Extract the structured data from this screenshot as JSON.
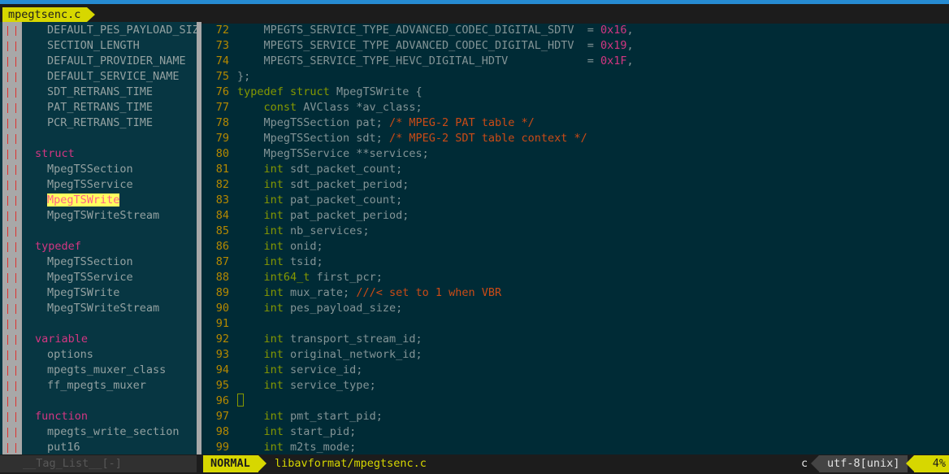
{
  "tab": {
    "label": "mpegtsenc.c"
  },
  "taglist": {
    "rows": [
      {
        "kind": "item",
        "text": "DEFAULT_PES_PAYLOAD_SIZE"
      },
      {
        "kind": "item",
        "text": "SECTION_LENGTH"
      },
      {
        "kind": "item",
        "text": "DEFAULT_PROVIDER_NAME"
      },
      {
        "kind": "item",
        "text": "DEFAULT_SERVICE_NAME"
      },
      {
        "kind": "item",
        "text": "SDT_RETRANS_TIME"
      },
      {
        "kind": "item",
        "text": "PAT_RETRANS_TIME"
      },
      {
        "kind": "item",
        "text": "PCR_RETRANS_TIME"
      },
      {
        "kind": "blank",
        "text": ""
      },
      {
        "kind": "header",
        "text": "struct"
      },
      {
        "kind": "item",
        "text": "MpegTSSection"
      },
      {
        "kind": "item",
        "text": "MpegTSService"
      },
      {
        "kind": "item-hl",
        "text": "MpegTSWrite"
      },
      {
        "kind": "item",
        "text": "MpegTSWriteStream"
      },
      {
        "kind": "blank",
        "text": ""
      },
      {
        "kind": "header",
        "text": "typedef"
      },
      {
        "kind": "item",
        "text": "MpegTSSection"
      },
      {
        "kind": "item",
        "text": "MpegTSService"
      },
      {
        "kind": "item",
        "text": "MpegTSWrite"
      },
      {
        "kind": "item",
        "text": "MpegTSWriteStream"
      },
      {
        "kind": "blank",
        "text": ""
      },
      {
        "kind": "header",
        "text": "variable"
      },
      {
        "kind": "item",
        "text": "options"
      },
      {
        "kind": "item",
        "text": "mpegts_muxer_class"
      },
      {
        "kind": "item",
        "text": "ff_mpegts_muxer"
      },
      {
        "kind": "blank",
        "text": ""
      },
      {
        "kind": "header",
        "text": "function"
      },
      {
        "kind": "item",
        "text": "mpegts_write_section"
      },
      {
        "kind": "item",
        "text": "put16"
      }
    ]
  },
  "code": {
    "lines": [
      {
        "n": "72",
        "parts": [
          [
            "txt",
            "    MPEGTS_SERVICE_TYPE_ADVANCED_CODEC_DIGITAL_SDTV  = "
          ],
          [
            "nm",
            "0x16"
          ],
          [
            "txt",
            ","
          ]
        ]
      },
      {
        "n": "73",
        "parts": [
          [
            "txt",
            "    MPEGTS_SERVICE_TYPE_ADVANCED_CODEC_DIGITAL_HDTV  = "
          ],
          [
            "nm",
            "0x19"
          ],
          [
            "txt",
            ","
          ]
        ]
      },
      {
        "n": "74",
        "parts": [
          [
            "txt",
            "    MPEGTS_SERVICE_TYPE_HEVC_DIGITAL_HDTV            = "
          ],
          [
            "nm",
            "0x1F"
          ],
          [
            "txt",
            ","
          ]
        ]
      },
      {
        "n": "75",
        "parts": [
          [
            "txt",
            "};"
          ]
        ]
      },
      {
        "n": "76",
        "parts": [
          [
            "kw",
            "typedef"
          ],
          [
            "txt",
            " "
          ],
          [
            "kw",
            "struct"
          ],
          [
            "txt",
            " MpegTSWrite {"
          ]
        ]
      },
      {
        "n": "77",
        "parts": [
          [
            "txt",
            "    "
          ],
          [
            "kw",
            "const"
          ],
          [
            "txt",
            " AVClass *av_class;"
          ]
        ]
      },
      {
        "n": "78",
        "parts": [
          [
            "txt",
            "    MpegTSSection pat; "
          ],
          [
            "cm",
            "/* MPEG-2 PAT table */"
          ]
        ]
      },
      {
        "n": "79",
        "parts": [
          [
            "txt",
            "    MpegTSSection sdt; "
          ],
          [
            "cm",
            "/* MPEG-2 SDT table context */"
          ]
        ]
      },
      {
        "n": "80",
        "parts": [
          [
            "txt",
            "    MpegTSService **services;"
          ]
        ]
      },
      {
        "n": "81",
        "parts": [
          [
            "txt",
            "    "
          ],
          [
            "tp",
            "int"
          ],
          [
            "txt",
            " sdt_packet_count;"
          ]
        ]
      },
      {
        "n": "82",
        "parts": [
          [
            "txt",
            "    "
          ],
          [
            "tp",
            "int"
          ],
          [
            "txt",
            " sdt_packet_period;"
          ]
        ]
      },
      {
        "n": "83",
        "parts": [
          [
            "txt",
            "    "
          ],
          [
            "tp",
            "int"
          ],
          [
            "txt",
            " pat_packet_count;"
          ]
        ]
      },
      {
        "n": "84",
        "parts": [
          [
            "txt",
            "    "
          ],
          [
            "tp",
            "int"
          ],
          [
            "txt",
            " pat_packet_period;"
          ]
        ]
      },
      {
        "n": "85",
        "parts": [
          [
            "txt",
            "    "
          ],
          [
            "tp",
            "int"
          ],
          [
            "txt",
            " nb_services;"
          ]
        ]
      },
      {
        "n": "86",
        "parts": [
          [
            "txt",
            "    "
          ],
          [
            "tp",
            "int"
          ],
          [
            "txt",
            " onid;"
          ]
        ]
      },
      {
        "n": "87",
        "parts": [
          [
            "txt",
            "    "
          ],
          [
            "tp",
            "int"
          ],
          [
            "txt",
            " tsid;"
          ]
        ]
      },
      {
        "n": "88",
        "parts": [
          [
            "txt",
            "    "
          ],
          [
            "tp",
            "int64_t"
          ],
          [
            "txt",
            " first_pcr;"
          ]
        ]
      },
      {
        "n": "89",
        "parts": [
          [
            "txt",
            "    "
          ],
          [
            "tp",
            "int"
          ],
          [
            "txt",
            " mux_rate; "
          ],
          [
            "cm",
            "///< set to 1 when VBR"
          ]
        ]
      },
      {
        "n": "90",
        "parts": [
          [
            "txt",
            "    "
          ],
          [
            "tp",
            "int"
          ],
          [
            "txt",
            " pes_payload_size;"
          ]
        ]
      },
      {
        "n": "91",
        "parts": []
      },
      {
        "n": "92",
        "parts": [
          [
            "txt",
            "    "
          ],
          [
            "tp",
            "int"
          ],
          [
            "txt",
            " transport_stream_id;"
          ]
        ]
      },
      {
        "n": "93",
        "parts": [
          [
            "txt",
            "    "
          ],
          [
            "tp",
            "int"
          ],
          [
            "txt",
            " original_network_id;"
          ]
        ]
      },
      {
        "n": "94",
        "parts": [
          [
            "txt",
            "    "
          ],
          [
            "tp",
            "int"
          ],
          [
            "txt",
            " service_id;"
          ]
        ]
      },
      {
        "n": "95",
        "parts": [
          [
            "txt",
            "    "
          ],
          [
            "tp",
            "int"
          ],
          [
            "txt",
            " service_type;"
          ]
        ]
      },
      {
        "n": "96",
        "parts": [
          [
            "cursor",
            ""
          ]
        ]
      },
      {
        "n": "97",
        "parts": [
          [
            "txt",
            "    "
          ],
          [
            "tp",
            "int"
          ],
          [
            "txt",
            " pmt_start_pid;"
          ]
        ]
      },
      {
        "n": "98",
        "parts": [
          [
            "txt",
            "    "
          ],
          [
            "tp",
            "int"
          ],
          [
            "txt",
            " start_pid;"
          ]
        ]
      },
      {
        "n": "99",
        "parts": [
          [
            "txt",
            "    "
          ],
          [
            "tp",
            "int"
          ],
          [
            "txt",
            " m2ts_mode;"
          ]
        ]
      }
    ]
  },
  "status": {
    "left": "__Tag_List__[-]",
    "mode": "NORMAL",
    "file": "libavformat/mpegtsenc.c",
    "filetype": "c",
    "encoding": "utf-8[unix]",
    "percent": "4%"
  }
}
